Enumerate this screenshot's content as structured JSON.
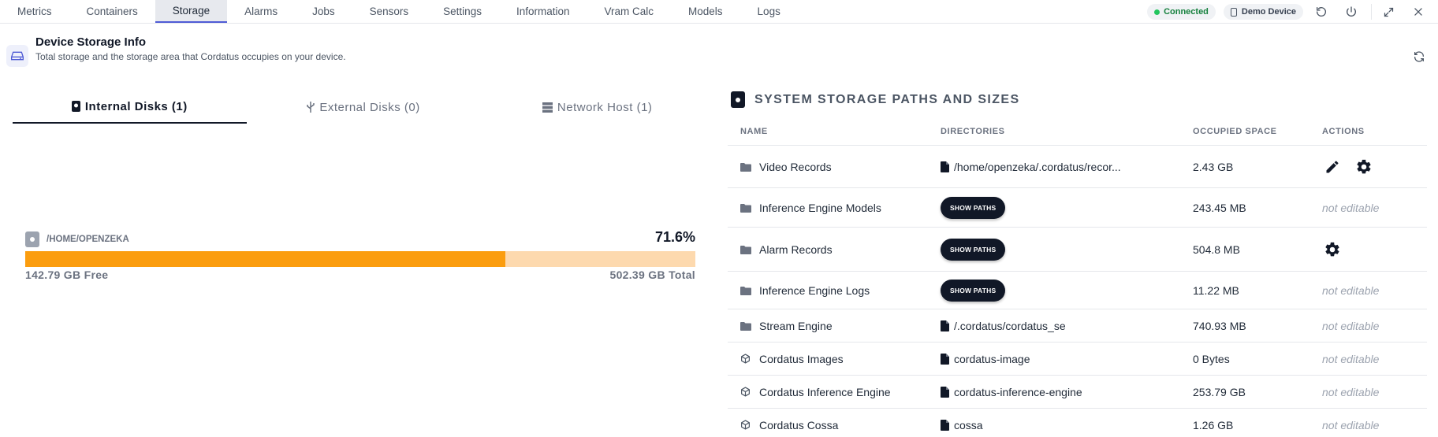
{
  "nav": {
    "tabs": [
      {
        "label": "Metrics"
      },
      {
        "label": "Containers"
      },
      {
        "label": "Storage"
      },
      {
        "label": "Alarms"
      },
      {
        "label": "Jobs"
      },
      {
        "label": "Sensors"
      },
      {
        "label": "Settings"
      },
      {
        "label": "Information"
      },
      {
        "label": "Vram Calc"
      },
      {
        "label": "Models"
      },
      {
        "label": "Logs"
      }
    ],
    "active_tab": "Storage",
    "status": "Connected",
    "device": "Demo Device",
    "icons": [
      "reset-icon",
      "power-icon",
      "expand-icon",
      "close-icon"
    ]
  },
  "header": {
    "title": "Device Storage Info",
    "subtitle": "Total storage and the storage area that Cordatus occupies on your device."
  },
  "disk_tabs": [
    {
      "label": "Internal Disks (1)",
      "icon": "hdd-icon"
    },
    {
      "label": "External Disks (0)",
      "icon": "usb-icon"
    },
    {
      "label": "Network Host (1)",
      "icon": "server-icon"
    }
  ],
  "disk": {
    "path": "/HOME/OPENZEKA",
    "percent_label": "71.6%",
    "used_fraction": 0.716,
    "free": "142.79 GB Free",
    "total": "502.39 GB Total",
    "colors": {
      "used": "#fb9d0f",
      "remaining": "#fdd9ae"
    }
  },
  "storage_table": {
    "title": "SYSTEM STORAGE PATHS AND SIZES",
    "headers": {
      "name": "NAME",
      "directories": "DIRECTORIES",
      "space": "OCCUPIED SPACE",
      "actions": "ACTIONS"
    },
    "show_paths_label": "SHOW PATHS",
    "not_editable_label": "not editable",
    "rows": [
      {
        "name": "Video Records",
        "icon": "folder-icon",
        "dir": "/home/openzeka/.cordatus/recor...",
        "size": "2.43 GB",
        "actions": [
          "edit",
          "settings"
        ]
      },
      {
        "name": "Inference Engine Models",
        "icon": "folder-icon",
        "dir": null,
        "size": "243.45 MB",
        "actions": []
      },
      {
        "name": "Alarm Records",
        "icon": "folder-icon",
        "dir": null,
        "size": "504.8 MB",
        "actions": [
          "settings"
        ]
      },
      {
        "name": "Inference Engine Logs",
        "icon": "folder-icon",
        "dir": null,
        "size": "11.22 MB",
        "actions": []
      },
      {
        "name": "Stream Engine",
        "icon": "folder-icon",
        "dir": "/.cordatus/cordatus_se",
        "size": "740.93 MB",
        "actions": []
      },
      {
        "name": "Cordatus Images",
        "icon": "cube-icon",
        "dir": "cordatus-image",
        "size": "0 Bytes",
        "actions": []
      },
      {
        "name": "Cordatus Inference Engine",
        "icon": "cube-icon",
        "dir": "cordatus-inference-engine",
        "size": "253.79 GB",
        "actions": []
      },
      {
        "name": "Cordatus Cossa",
        "icon": "cube-icon",
        "dir": "cossa",
        "size": "1.26 GB",
        "actions": []
      }
    ]
  }
}
